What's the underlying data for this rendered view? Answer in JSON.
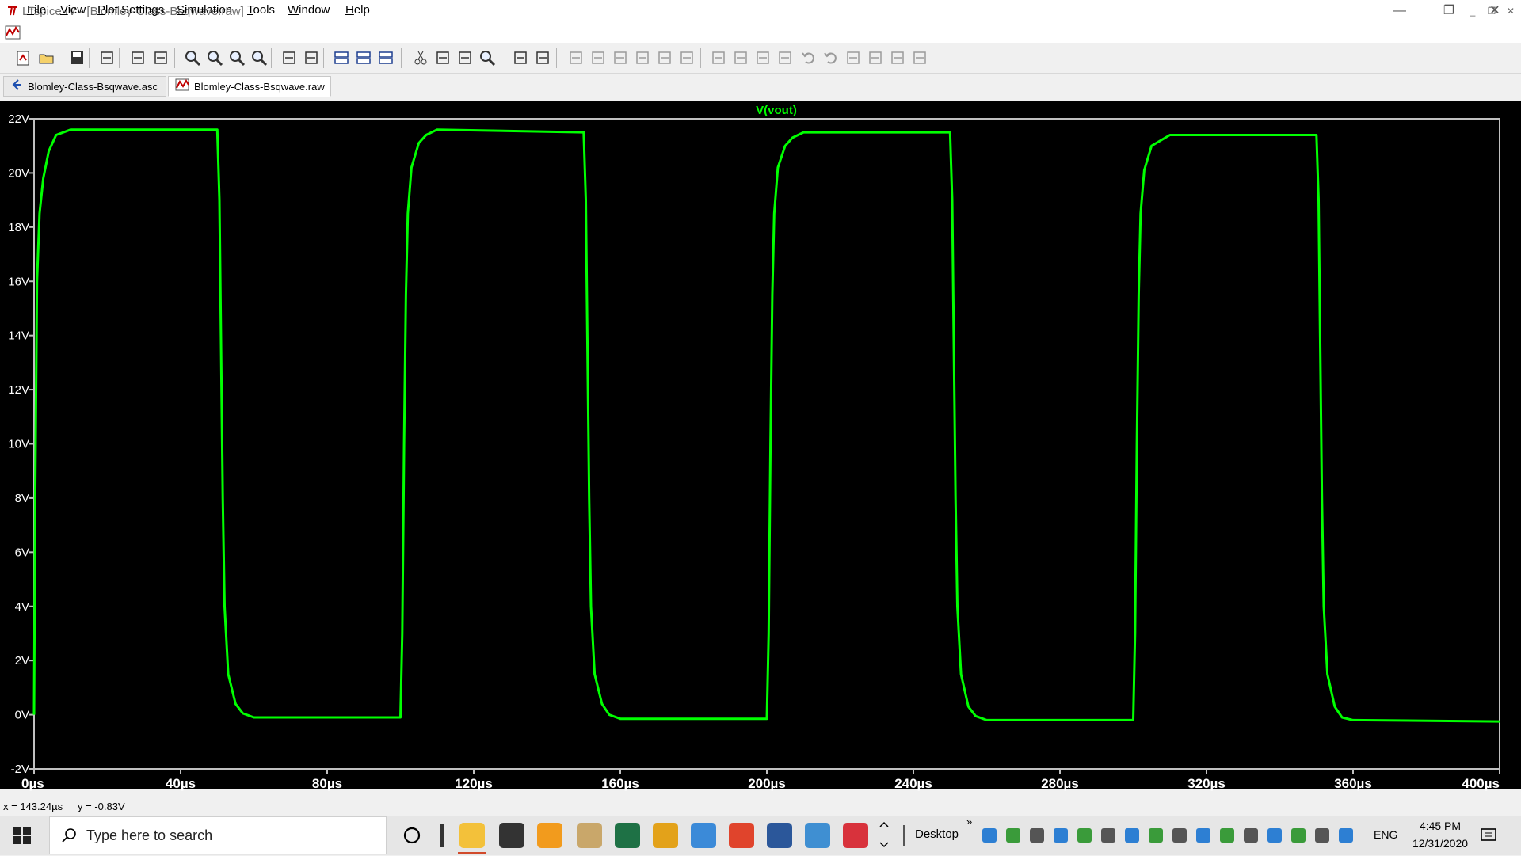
{
  "window": {
    "title": "LTspice IV - [Blomley-Class-Bsqwave.raw]",
    "controls": {
      "minimize": "—",
      "restore": "❐",
      "close": "✕"
    }
  },
  "menu": {
    "items": [
      {
        "label": "File",
        "accel": "F"
      },
      {
        "label": "View",
        "accel": "V"
      },
      {
        "label": "Plot Settings",
        "accel": "P"
      },
      {
        "label": "Simulation",
        "accel": "S"
      },
      {
        "label": "Tools",
        "accel": "T"
      },
      {
        "label": "Window",
        "accel": "W"
      },
      {
        "label": "Help",
        "accel": "H"
      }
    ]
  },
  "tabs": [
    {
      "label": "Blomley-Class-Bsqwave.asc",
      "icon": "schematic-icon",
      "active": false
    },
    {
      "label": "Blomley-Class-Bsqwave.raw",
      "icon": "waveform-icon",
      "active": true
    }
  ],
  "plot": {
    "trace_name": "V(vout)",
    "trace_color": "#00ff00",
    "background": "#000000",
    "grid_color": "#c0c0c0"
  },
  "chart_data": {
    "type": "line",
    "title": "V(vout)",
    "xlabel": "",
    "ylabel": "",
    "x_unit": "µs",
    "y_unit": "V",
    "xlim": [
      0,
      400
    ],
    "ylim": [
      -2,
      22
    ],
    "x_ticks": [
      "0µs",
      "40µs",
      "80µs",
      "120µs",
      "160µs",
      "200µs",
      "240µs",
      "280µs",
      "320µs",
      "360µs",
      "400µs"
    ],
    "y_ticks": [
      "-2V",
      "0V",
      "2V",
      "4V",
      "6V",
      "8V",
      "10V",
      "12V",
      "14V",
      "16V",
      "18V",
      "20V",
      "22V"
    ],
    "series": [
      {
        "name": "V(vout)",
        "color": "#00ff00",
        "x": [
          0,
          0.3,
          0.8,
          1.5,
          2.5,
          4,
          6,
          10,
          50,
          50.6,
          51,
          51.5,
          52,
          53,
          55,
          57,
          60,
          100,
          100.5,
          101,
          101.5,
          102,
          103,
          105,
          107,
          110,
          150,
          150.6,
          151,
          151.5,
          152,
          153,
          155,
          157,
          160,
          200,
          200.5,
          201,
          201.5,
          202,
          203,
          205,
          207,
          210,
          250,
          250.6,
          251,
          251.5,
          252,
          253,
          255,
          257,
          260,
          300,
          300.5,
          301,
          301.5,
          302,
          303,
          305,
          207.0,
          310,
          350,
          350.6,
          351,
          351.5,
          352,
          353,
          355,
          357,
          360,
          400
        ],
        "y": [
          0,
          8,
          16,
          18.5,
          19.8,
          20.8,
          21.4,
          21.6,
          21.6,
          19,
          14,
          8,
          4,
          1.5,
          0.4,
          0.05,
          -0.1,
          -0.1,
          3,
          10,
          15.5,
          18.5,
          20.2,
          21.1,
          21.4,
          21.6,
          21.5,
          19,
          14,
          8,
          4,
          1.5,
          0.4,
          0.0,
          -0.15,
          -0.15,
          3,
          10,
          15.5,
          18.5,
          20.2,
          21.0,
          21.3,
          21.5,
          21.5,
          19,
          14,
          8,
          4,
          1.5,
          0.3,
          -0.05,
          -0.2,
          -0.2,
          3,
          10,
          15.5,
          18.5,
          20.1,
          21.0,
          21.3,
          21.4,
          21.4,
          19,
          14,
          8,
          4,
          1.5,
          0.3,
          -0.1,
          -0.2,
          -0.25
        ]
      }
    ]
  },
  "status": {
    "cursor_x": "x = 143.24µs",
    "cursor_y": "y = -0.83V"
  },
  "taskbar": {
    "search_placeholder": "Type here to search",
    "desktop_label": "Desktop",
    "language": "ENG",
    "time": "4:45 PM",
    "date": "12/31/2020"
  }
}
